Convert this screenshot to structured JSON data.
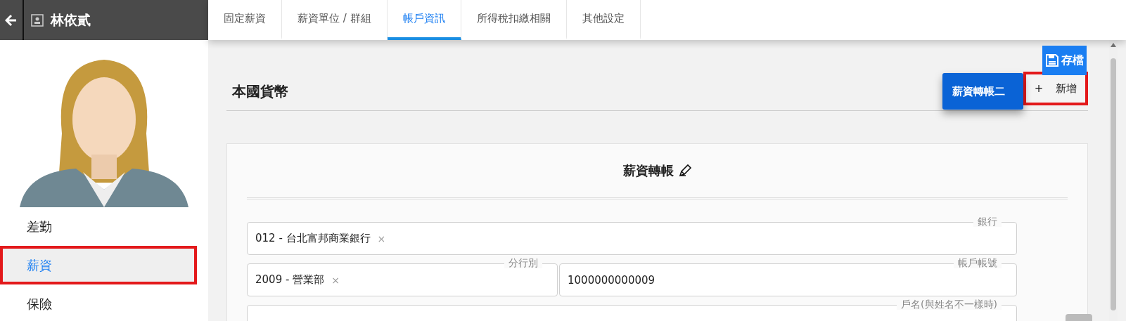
{
  "header": {
    "name": "林依貳"
  },
  "tabs": [
    {
      "label": "固定薪資",
      "selected": false
    },
    {
      "label": "薪資單位 / 群組",
      "selected": false
    },
    {
      "label": "帳戶資訊",
      "selected": true
    },
    {
      "label": "所得稅扣繳相關",
      "selected": false
    },
    {
      "label": "其他設定",
      "selected": false
    }
  ],
  "sidebar": {
    "items": [
      {
        "label": "差勤",
        "selected": false,
        "highlighted": false
      },
      {
        "label": "薪資",
        "selected": true,
        "highlighted": true
      },
      {
        "label": "保險",
        "selected": false,
        "highlighted": false
      }
    ]
  },
  "save_button": {
    "label": "存檔"
  },
  "section_title": "本國貨幣",
  "account_tabs": [
    {
      "label": "薪資轉帳二",
      "selected": true
    }
  ],
  "add_button": {
    "label": "+",
    "text": "新增",
    "highlighted": true
  },
  "card": {
    "title": "薪資轉帳",
    "field_rows": [
      [
        {
          "label": "銀行",
          "value": "012 - 台北富邦商業銀行",
          "clear": "×"
        }
      ],
      [
        {
          "label": "分行別",
          "value": "2009 - 營業部",
          "clear": "×"
        },
        {
          "label": "帳戶帳號",
          "value": "1000000000009"
        }
      ],
      [
        {
          "label": "戶名(與姓名不一樣時)"
        }
      ]
    ]
  }
}
